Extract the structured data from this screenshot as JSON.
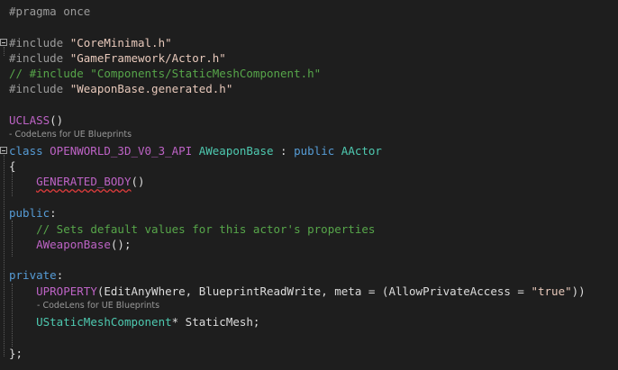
{
  "editor": {
    "language": "C++",
    "lines": {
      "l1": [
        {
          "t": "#pragma once",
          "c": "pre"
        }
      ],
      "l3": [
        {
          "t": "#include ",
          "c": "pre"
        },
        {
          "t": "\"CoreMinimal.h\"",
          "c": "str"
        }
      ],
      "l4": [
        {
          "t": "#include ",
          "c": "pre"
        },
        {
          "t": "\"GameFramework/Actor.h\"",
          "c": "str"
        }
      ],
      "l5": [
        {
          "t": "// #include \"Components/StaticMeshComponent.h\"",
          "c": "com"
        }
      ],
      "l6": [
        {
          "t": "#include ",
          "c": "pre"
        },
        {
          "t": "\"WeaponBase.generated.h\"",
          "c": "str"
        }
      ],
      "l8": [
        {
          "t": "UCLASS",
          "c": "mac"
        },
        {
          "t": "()",
          "c": "plain"
        }
      ],
      "l9": [
        {
          "t": "class ",
          "c": "kw"
        },
        {
          "t": "OPENWORLD_3D_V0_3_API ",
          "c": "mac"
        },
        {
          "t": "AWeaponBase ",
          "c": "type"
        },
        {
          "t": ": ",
          "c": "plain"
        },
        {
          "t": "public ",
          "c": "kw"
        },
        {
          "t": "AActor",
          "c": "type"
        }
      ],
      "l10": [
        {
          "t": "{",
          "c": "plain"
        }
      ],
      "l11": [
        {
          "t": "    ",
          "c": "plain"
        },
        {
          "t": "GENERATED_BODY",
          "c": "mac",
          "sq": true
        },
        {
          "t": "()",
          "c": "plain"
        }
      ],
      "l13": [
        {
          "t": "public",
          "c": "kw"
        },
        {
          "t": ":",
          "c": "plain"
        }
      ],
      "l14": [
        {
          "t": "    ",
          "c": "plain"
        },
        {
          "t": "// Sets default values for this actor's properties",
          "c": "com"
        }
      ],
      "l15": [
        {
          "t": "    ",
          "c": "plain"
        },
        {
          "t": "AWeaponBase",
          "c": "mac"
        },
        {
          "t": "();",
          "c": "plain"
        }
      ],
      "l17": [
        {
          "t": "private",
          "c": "kw"
        },
        {
          "t": ":",
          "c": "plain"
        }
      ],
      "l18": [
        {
          "t": "    ",
          "c": "plain"
        },
        {
          "t": "UPROPERTY",
          "c": "mac"
        },
        {
          "t": "(EditAnyWhere, BlueprintReadWrite, meta = (AllowPrivateAccess = ",
          "c": "plain"
        },
        {
          "t": "\"true\"",
          "c": "str"
        },
        {
          "t": "))",
          "c": "plain"
        }
      ],
      "l19": [
        {
          "t": "    ",
          "c": "plain"
        },
        {
          "t": "UStaticMeshComponent",
          "c": "type"
        },
        {
          "t": "* StaticMesh;",
          "c": "plain"
        }
      ],
      "l21": [
        {
          "t": "};",
          "c": "plain"
        }
      ]
    },
    "codelens_uclass": "- CodeLens for UE Blueprints",
    "codelens_uproperty": "- CodeLens for UE Blueprints"
  }
}
